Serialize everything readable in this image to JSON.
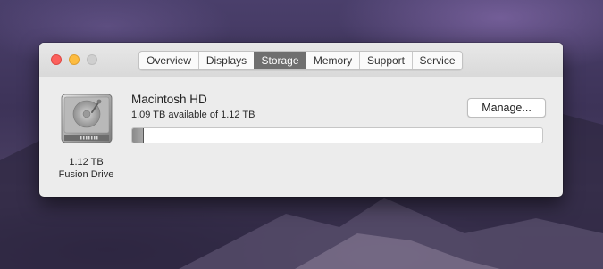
{
  "window": {
    "tabs": [
      {
        "label": "Overview",
        "active": false
      },
      {
        "label": "Displays",
        "active": false
      },
      {
        "label": "Storage",
        "active": true
      },
      {
        "label": "Memory",
        "active": false
      },
      {
        "label": "Support",
        "active": false
      },
      {
        "label": "Service",
        "active": false
      }
    ]
  },
  "drive": {
    "icon": "hard-drive-icon",
    "capacity_label": "1.12 TB",
    "type_label": "Fusion Drive",
    "name": "Macintosh HD",
    "available_text": "1.09 TB available of 1.12 TB",
    "used_fraction": 0.027,
    "manage_label": "Manage..."
  },
  "colors": {
    "active_tab": "#6f6f6f",
    "close": "#fc605c",
    "minimize": "#fdbc40",
    "zoom_disabled": "#cfcfcf"
  }
}
